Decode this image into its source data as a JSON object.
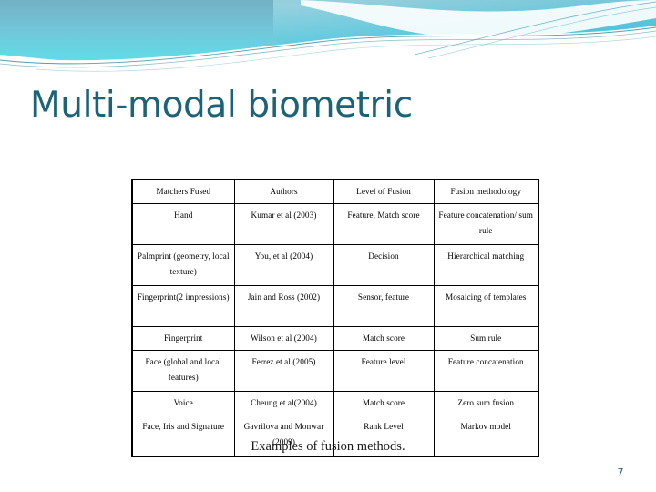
{
  "slide": {
    "title": "Multi-modal biometric",
    "caption": "Examples of fusion methods.",
    "page_number": "7",
    "title_color": "#1d6378",
    "accent_colors": {
      "band_top": "#6aaec6",
      "band_bottom": "#5fd8e6",
      "wave_line": "#2e8a9c",
      "wave_fill": "#8fe3ec"
    }
  },
  "table": {
    "headers": [
      "Matchers Fused",
      "Authors",
      "Level of Fusion",
      "Fusion methodology"
    ],
    "rows": [
      {
        "matchers": "Hand",
        "authors": "Kumar et al (2003)",
        "level": "Feature, Match score",
        "methodology": "Feature concatenation/ sum rule"
      },
      {
        "matchers": "Palmprint (geometry, local texture)",
        "authors": "You, et al (2004)",
        "level": "Decision",
        "methodology": "Hierarchical matching"
      },
      {
        "matchers": "Fingerprint(2 impressions)",
        "authors": "Jain and Ross (2002)",
        "level": "Sensor, feature",
        "methodology": "Mosaicing of templates"
      },
      {
        "matchers": "Fingerprint",
        "authors": "Wilson et al (2004)",
        "level": "Match score",
        "methodology": "Sum rule"
      },
      {
        "matchers": "Face (global and local features)",
        "authors": "Ferrez et al (2005)",
        "level": "Feature level",
        "methodology": "Feature concatenation"
      },
      {
        "matchers": "Voice",
        "authors": "Cheung et al(2004)",
        "level": "Match score",
        "methodology": "Zero sum fusion"
      },
      {
        "matchers": "Face, Iris and Signature",
        "authors": "Gavrilova and Monwar (2009)",
        "level": "Rank Level",
        "methodology": "Markov model"
      }
    ]
  }
}
